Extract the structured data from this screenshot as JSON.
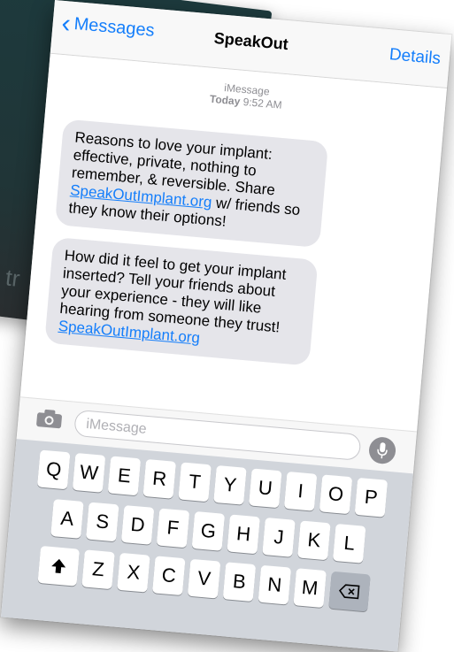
{
  "background": {
    "partial_text": "tr"
  },
  "navbar": {
    "back_label": "Messages",
    "title": "SpeakOut",
    "details_label": "Details"
  },
  "thread": {
    "service": "iMessage",
    "day": "Today",
    "time": "9:52 AM",
    "messages": [
      {
        "text_before": "Reasons to love your implant: effective, private, nothing to remember, & reversible. Share ",
        "link": "SpeakOutImplant.org",
        "text_after": " w/ friends so they know their options!"
      },
      {
        "text_before": "How did it feel to get your implant inserted? Tell your friends about your experience - they will like hearing from someone they trust! ",
        "link": "SpeakOutImplant.org",
        "text_after": ""
      }
    ]
  },
  "input": {
    "placeholder": "iMessage"
  },
  "keyboard": {
    "row1": [
      "Q",
      "W",
      "E",
      "R",
      "T",
      "Y",
      "U",
      "I",
      "O",
      "P"
    ],
    "row2": [
      "A",
      "S",
      "D",
      "F",
      "G",
      "H",
      "J",
      "K",
      "L"
    ],
    "row3": [
      "Z",
      "X",
      "C",
      "V",
      "B",
      "N",
      "M"
    ]
  },
  "colors": {
    "accent": "#147efb",
    "bubble": "#e5e5ea",
    "keyboard": "#d1d5db"
  }
}
